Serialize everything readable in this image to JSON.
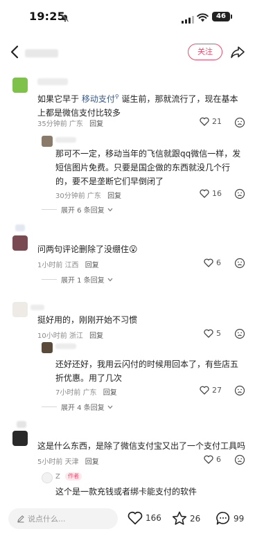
{
  "status": {
    "time": "19:25",
    "battery": "46"
  },
  "nav": {
    "follow_label": "关注"
  },
  "comments": [
    {
      "text_pre": "如果它早于",
      "text_link": "移动支付",
      "text_post": "诞生前，那就流行了，现在基本上都是微信支付比较多",
      "time": "35分钟前",
      "location": "广东",
      "reply_label": "回复",
      "likes": "21",
      "replies": [
        {
          "text": "那可不一定，移动当年的飞信就跟qq微信一样，发短信图片免费。只要是国企做的东西就没几个行的，要不是垄断它们早倒闭了",
          "time": "30分钟前",
          "location": "广东",
          "reply_label": "回复",
          "likes": "16"
        }
      ],
      "expand_label": "展开 6 条回复"
    },
    {
      "text": "问两句评论删除了没绷住😮",
      "time": "1小时前",
      "location": "江西",
      "reply_label": "回复",
      "likes": "6",
      "expand_label": "展开 1 条回复"
    },
    {
      "text": "挺好用的，刚刚开始不习惯",
      "time": "10小时前",
      "location": "浙江",
      "reply_label": "回复",
      "likes": "5",
      "replies": [
        {
          "text": "还好还好，我用云闪付的时候用回本了，有些店五折优惠。用了几次",
          "time": "7小时前",
          "location": "广东",
          "reply_label": "回复",
          "likes": "27"
        }
      ],
      "expand_label": "展开 4 条回复"
    },
    {
      "text": "这是什么东西，是除了微信支付宝又出了一个支付工具吗",
      "time": "5小时前",
      "location": "天津",
      "reply_label": "回复",
      "likes": "6",
      "replies": [
        {
          "author": "Z",
          "badge": "作者",
          "text": "这个是一款充钱或者绑卡能支付的软件"
        }
      ]
    }
  ],
  "bottom": {
    "input_placeholder": "说点什么...",
    "likes": "166",
    "stars": "26",
    "comments": "99"
  }
}
